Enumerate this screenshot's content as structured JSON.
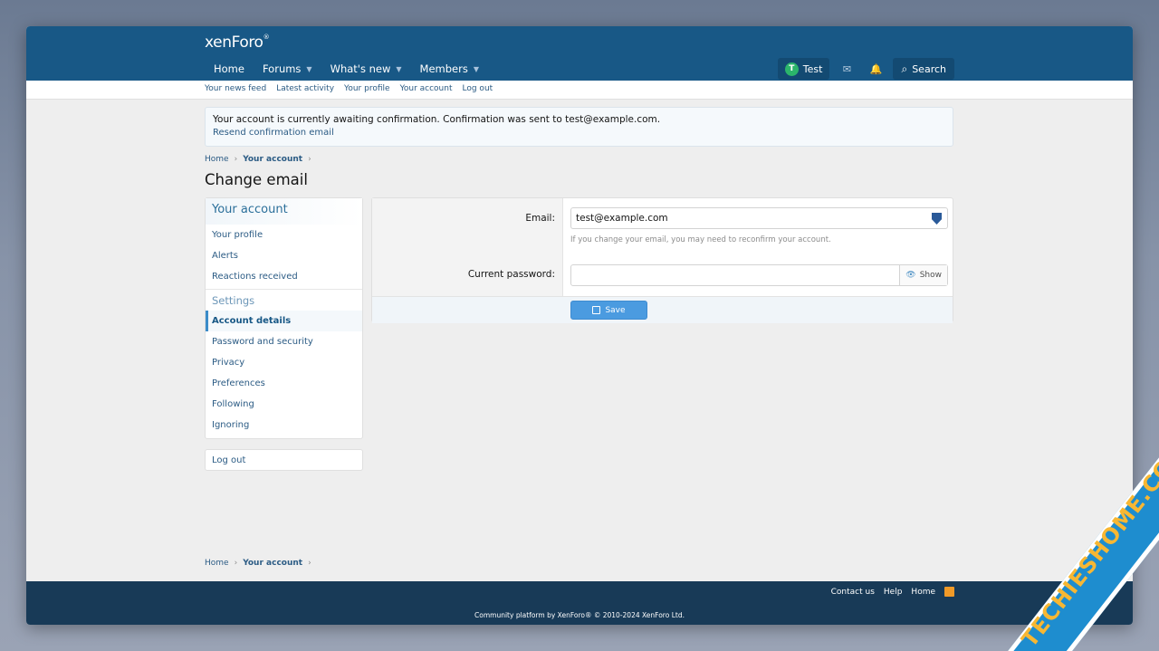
{
  "header": {
    "logo": "xenForo",
    "logo_mark": "®",
    "nav": [
      {
        "label": "Home",
        "has_caret": false
      },
      {
        "label": "Forums",
        "has_caret": true
      },
      {
        "label": "What's new",
        "has_caret": true
      },
      {
        "label": "Members",
        "has_caret": true
      }
    ],
    "user_initial": "T",
    "user_name": "Test",
    "search_label": "Search"
  },
  "subnav": [
    "Your news feed",
    "Latest activity",
    "Your profile",
    "Your account",
    "Log out"
  ],
  "notice": {
    "message": "Your account is currently awaiting confirmation. Confirmation was sent to test@example.com.",
    "link": "Resend confirmation email"
  },
  "breadcrumb": {
    "home": "Home",
    "current": "Your account"
  },
  "page_title": "Change email",
  "sidebar": {
    "heading": "Your account",
    "items": [
      "Your profile",
      "Alerts",
      "Reactions received"
    ],
    "settings_heading": "Settings",
    "settings_items": [
      "Account details",
      "Password and security",
      "Privacy",
      "Preferences",
      "Following",
      "Ignoring"
    ],
    "active_item": "Account details",
    "logout": "Log out"
  },
  "form": {
    "email_label": "Email:",
    "email_value": "test@example.com",
    "email_hint": "If you change your email, you may need to reconfirm your account.",
    "password_label": "Current password:",
    "password_value": "",
    "show_label": "Show",
    "save_label": "Save"
  },
  "footer": {
    "links": [
      "Contact us",
      "Help",
      "Home"
    ],
    "copyright": "Community platform by XenForo® © 2010-2024 XenForo Ltd."
  },
  "watermark": "TECHIESHOME.COM",
  "colors": {
    "header": "#185886",
    "footer": "#183a57",
    "accent": "#4b9be0",
    "avatar": "#2bb56b"
  }
}
